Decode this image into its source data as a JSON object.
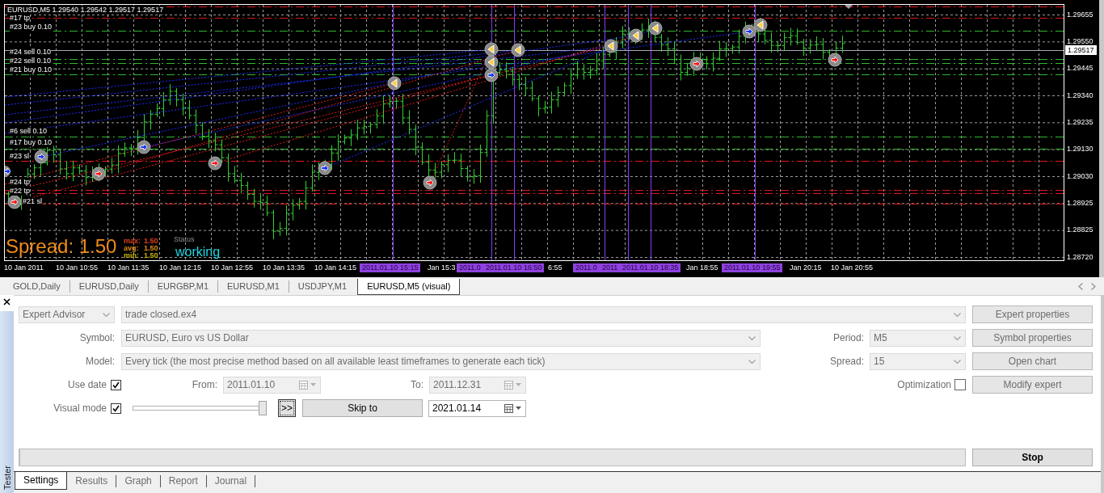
{
  "chart": {
    "title": "EURUSD,M5 1.29540 1.29542 1.29517 1.29517",
    "order_labels": [
      "#17 tp",
      "#23 buy 0.10",
      "#24 sell 0.10",
      "#22 sell 0.10",
      "#21 buy 0.10",
      "#6 sell 0.10",
      "#17 buy 0.10",
      "#23 sl",
      "#24 tp",
      "#22 tp",
      "#21 sl"
    ],
    "trade_markers": [
      {
        "kind": "buy"
      },
      {
        "kind": "sell"
      },
      {
        "kind": "buy"
      },
      {
        "kind": "sell"
      },
      {
        "kind": "buy"
      },
      {
        "kind": "sell"
      },
      {
        "kind": "buy"
      },
      {
        "kind": "close"
      },
      {
        "kind": "sell"
      },
      {
        "kind": "close"
      },
      {
        "kind": "close"
      },
      {
        "kind": "buy"
      },
      {
        "kind": "close"
      },
      {
        "kind": "close"
      },
      {
        "kind": "close"
      },
      {
        "kind": "close"
      },
      {
        "kind": "sell"
      },
      {
        "kind": "buy"
      },
      {
        "kind": "close"
      },
      {
        "kind": "sell"
      }
    ],
    "price_axis": [
      "1.29655",
      "1.29550",
      "1.29445",
      "1.29340",
      "1.29235",
      "1.29130",
      "1.29030",
      "1.28925",
      "1.28825",
      "1.28720"
    ],
    "current_price": "1.29517",
    "time_axis": [
      {
        "text": "10 Jan 2011",
        "highlighted": false
      },
      {
        "text": "10 Jan 10:55",
        "highlighted": false
      },
      {
        "text": "10 Jan 11:35",
        "highlighted": false
      },
      {
        "text": "10 Jan 12:15",
        "highlighted": false
      },
      {
        "text": "10 Jan 12:55",
        "highlighted": false
      },
      {
        "text": "10 Jan 13:35",
        "highlighted": false
      },
      {
        "text": "10 Jan 14:15",
        "highlighted": false
      },
      {
        "text": "2011.01.10 15:15",
        "highlighted": true
      },
      {
        "text": "Jan 15:3",
        "highlighted": false
      },
      {
        "text": "2011.0",
        "highlighted": true
      },
      {
        "text": "2011.01.10 16:50",
        "highlighted": true
      },
      {
        "text": "6:55",
        "highlighted": false
      },
      {
        "text": "2011.0",
        "highlighted": true
      },
      {
        "text": "2011",
        "highlighted": true
      },
      {
        "text": "2011.01.10 18:35",
        "highlighted": true
      },
      {
        "text": "Jan 18:55",
        "highlighted": false
      },
      {
        "text": "2011.01.10 19:55",
        "highlighted": true
      },
      {
        "text": "Jan 20:15",
        "highlighted": false
      },
      {
        "text": "10 Jan 20:55",
        "highlighted": false
      }
    ],
    "spread": {
      "text": "Spread: 1.50",
      "stats": [
        {
          "label": "max:",
          "value": "1.50",
          "color": "#e0401c"
        },
        {
          "label": "avg:",
          "value": "1.50",
          "color": "#e08c14"
        },
        {
          "label": "min:",
          "value": "1.50",
          "color": "#c8b400"
        }
      ],
      "status_label": "Status",
      "status": "working"
    }
  },
  "chart_tabs": [
    {
      "label": "GOLD,Daily",
      "selected": false
    },
    {
      "label": "EURUSD,Daily",
      "selected": false
    },
    {
      "label": "EURGBP,M1",
      "selected": false
    },
    {
      "label": "EURUSD,M1",
      "selected": false
    },
    {
      "label": "USDJPY,M1",
      "selected": false
    },
    {
      "label": "EURUSD,M5 (visual)",
      "selected": true
    }
  ],
  "tester": {
    "title": "Tester",
    "expert_type": {
      "value": "Expert Advisor",
      "disabled": true
    },
    "expert": {
      "value": "trade closed.ex4",
      "disabled": true
    },
    "symbol": {
      "label": "Symbol:",
      "value": "EURUSD, Euro vs US Dollar",
      "disabled": true
    },
    "period": {
      "label": "Period:",
      "value": "M5",
      "disabled": true
    },
    "model": {
      "label": "Model:",
      "value": "Every tick (the most precise method based on all available least timeframes to generate each tick)",
      "disabled": true
    },
    "spread": {
      "label": "Spread:",
      "value": "15",
      "disabled": true
    },
    "use_date": {
      "label": "Use date",
      "checked": true
    },
    "from": {
      "label": "From:",
      "value": "2011.01.10",
      "disabled": true
    },
    "to": {
      "label": "To:",
      "value": "2011.12.31",
      "disabled": true
    },
    "optimization": {
      "label": "Optimization",
      "checked": false
    },
    "visual_mode": {
      "label": "Visual mode",
      "checked": true
    },
    "speed": {
      "level": 1
    },
    "fast_forward": {
      "label": ">>"
    },
    "skip_to": {
      "label": "Skip to"
    },
    "skip_date": {
      "value": "2021.01.14",
      "disabled": false
    },
    "progress": {
      "level": 0
    },
    "buttons": [
      {
        "label": "Expert properties",
        "disabled": true
      },
      {
        "label": "Symbol properties",
        "disabled": true
      },
      {
        "label": "Open chart",
        "disabled": true
      },
      {
        "label": "Modify expert",
        "disabled": true
      }
    ],
    "stop": {
      "label": "Stop",
      "disabled": false
    },
    "tabs": [
      {
        "label": "Settings",
        "selected": true
      },
      {
        "label": "Results",
        "selected": false
      },
      {
        "label": "Graph",
        "selected": false
      },
      {
        "label": "Report",
        "selected": false
      },
      {
        "label": "Journal",
        "selected": false
      }
    ]
  }
}
